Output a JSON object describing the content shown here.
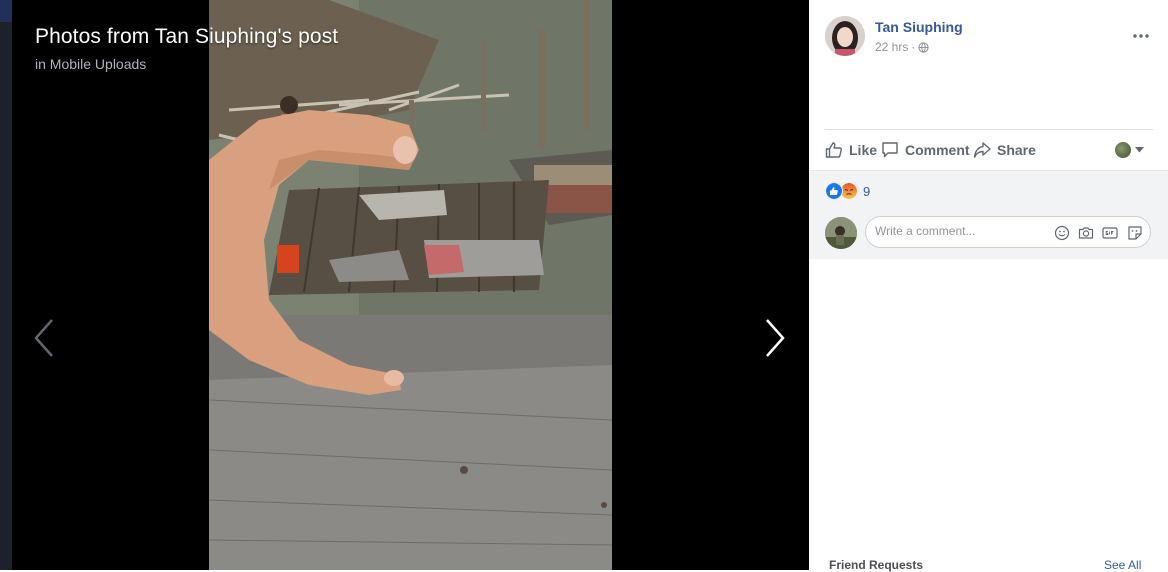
{
  "viewer": {
    "title": "Photos from Tan Siuphing's post",
    "subtitle": "in Mobile Uploads"
  },
  "post": {
    "author": "Tan Siuphing",
    "time": "22 hrs",
    "separator": "·",
    "privacy_icon": "globe-icon",
    "more_icon": "more-icon"
  },
  "actions": {
    "like": "Like",
    "comment": "Comment",
    "share": "Share"
  },
  "reactions": {
    "types": [
      "like",
      "angry"
    ],
    "count": "9"
  },
  "comment_box": {
    "placeholder": "Write a comment...",
    "icons": [
      "emoji-icon",
      "camera-icon",
      "gif-icon",
      "sticker-icon"
    ]
  },
  "sidebar": {
    "friend_requests": "Friend Requests",
    "see_all": "See All"
  },
  "colors": {
    "link_blue": "#365899",
    "like_blue": "#1877f2",
    "angry_orange": "#f0772b",
    "viewer_bg": "#000000"
  }
}
